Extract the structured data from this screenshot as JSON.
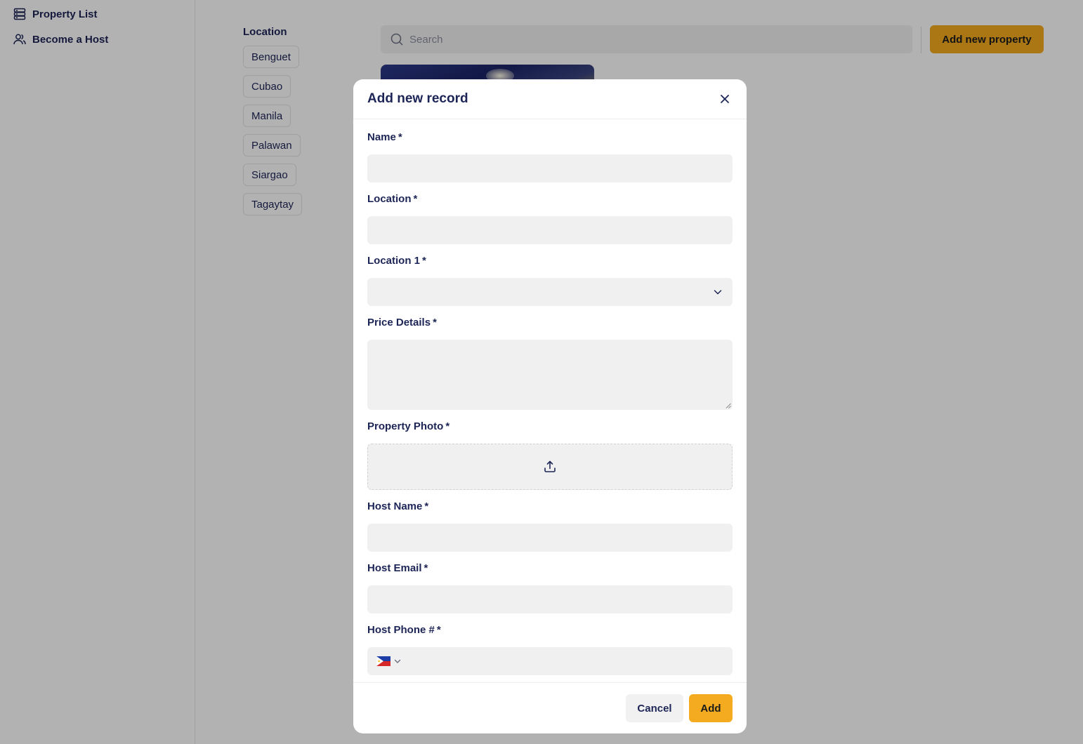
{
  "sidebar": {
    "items": [
      {
        "label": "Property List",
        "icon": "server-stack-icon"
      },
      {
        "label": "Become a Host",
        "icon": "users-icon"
      }
    ]
  },
  "filters": {
    "title": "Location",
    "chips": [
      "Benguet",
      "Cubao",
      "Manila",
      "Palawan",
      "Siargao",
      "Tagaytay"
    ]
  },
  "search": {
    "placeholder": "Search"
  },
  "toolbar": {
    "add_property_label": "Add new property"
  },
  "modal": {
    "title": "Add new record",
    "fields": {
      "name": {
        "label": "Name",
        "required": "*",
        "value": ""
      },
      "location": {
        "label": "Location",
        "required": "*",
        "value": ""
      },
      "location1": {
        "label": "Location 1",
        "required": "*",
        "value": ""
      },
      "price_details": {
        "label": "Price Details",
        "required": "*",
        "value": ""
      },
      "property_photo": {
        "label": "Property Photo",
        "required": "*"
      },
      "host_name": {
        "label": "Host Name",
        "required": "*",
        "value": ""
      },
      "host_email": {
        "label": "Host Email",
        "required": "*",
        "value": ""
      },
      "host_phone": {
        "label": "Host Phone #",
        "required": "*",
        "value": "",
        "country_flag": "philippines-flag-icon"
      }
    },
    "buttons": {
      "cancel": "Cancel",
      "add": "Add"
    }
  },
  "colors": {
    "accent": "#f5ab1f",
    "text": "#1d2556",
    "input_bg": "#f0f0f0",
    "overlay": "rgba(0,0,0,0.3)"
  }
}
